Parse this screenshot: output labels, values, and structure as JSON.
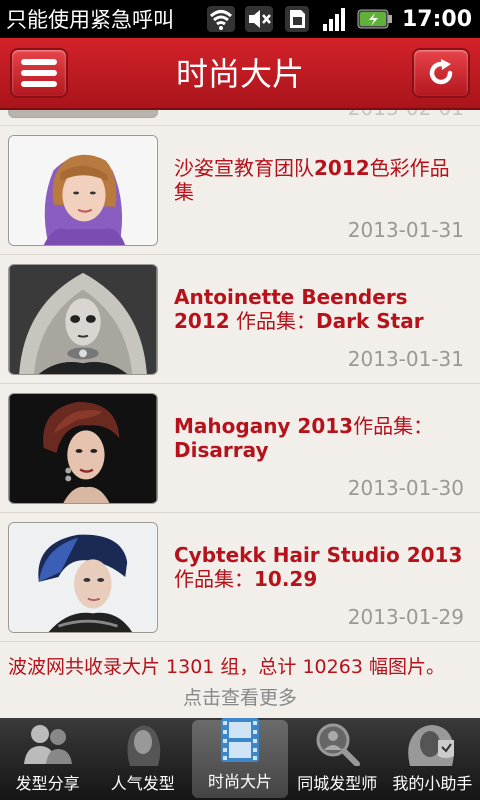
{
  "status_bar": {
    "notification": "只能使用紧急呼叫",
    "time": "17:00",
    "icons": [
      "wifi-icon",
      "mute-icon",
      "sim-icon",
      "signal-icon",
      "battery-icon"
    ]
  },
  "header": {
    "title": "时尚大片",
    "menu_icon": "menu-icon",
    "refresh_icon": "refresh-icon"
  },
  "partial_top_item": {
    "date": "2013-02-01"
  },
  "items": [
    {
      "title_pre": "沙姿宣教育团队",
      "title_bold": "2012",
      "title_post": "色彩作品集",
      "date": "2013-01-31"
    },
    {
      "title_pre": "",
      "title_bold": "Antoinette Beenders 2012",
      "title_post": " 作品集：",
      "title_bold2": "Dark Star",
      "date": "2013-01-31"
    },
    {
      "title_pre": "",
      "title_bold": "Mahogany 2013",
      "title_post": "作品集：",
      "title_bold2": "Disarray",
      "date": "2013-01-30"
    },
    {
      "title_pre": "",
      "title_bold": "Cybtekk Hair Studio 2013",
      "title_post": "作品集：",
      "title_bold2": "10.29",
      "date": "2013-01-29"
    }
  ],
  "summary": "波波网共收录大片 1301 组，总计 10263 幅图片。",
  "load_more": "点击查看更多",
  "tabs": [
    {
      "label": "发型分享",
      "icon": "users-icon",
      "active": false
    },
    {
      "label": "人气发型",
      "icon": "hair-silhouette-icon",
      "active": false
    },
    {
      "label": "时尚大片",
      "icon": "film-icon",
      "active": true
    },
    {
      "label": "同城发型师",
      "icon": "search-person-icon",
      "active": false
    },
    {
      "label": "我的小助手",
      "icon": "assistant-icon",
      "active": false
    }
  ],
  "colors": {
    "accent": "#b5121b",
    "header_red": "#c41c24",
    "background": "#f2eeea",
    "date_gray": "#9c9894"
  }
}
